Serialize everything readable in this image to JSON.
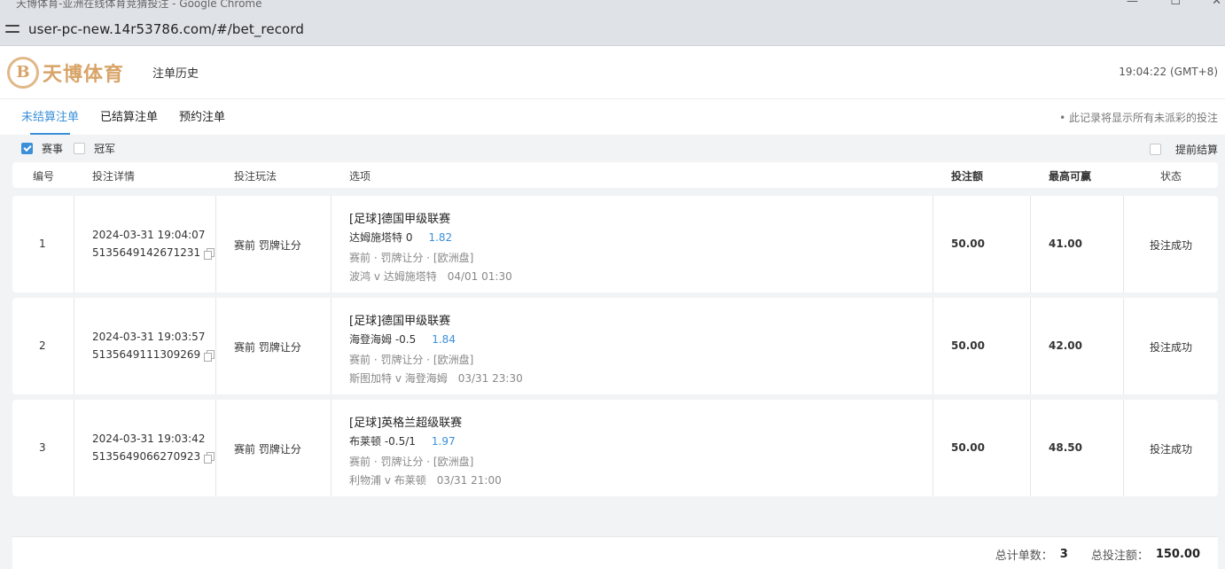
{
  "browser": {
    "window_title": "天博体育-亚洲在线体育竞猜投注 - Google Chrome",
    "url": "user-pc-new.14r53786.com/#/bet_record",
    "controls": {
      "minimize": "—",
      "maximize": "☐",
      "close": "✕"
    }
  },
  "header": {
    "logo_mark": "B",
    "logo_text": "天博体育",
    "nav_history": "注单历史",
    "clock": "19:04:22 (GMT+8)"
  },
  "tabs": [
    {
      "label": "未结算注单",
      "active": true
    },
    {
      "label": "已结算注单",
      "active": false
    },
    {
      "label": "预约注单",
      "active": false
    }
  ],
  "tabs_note": "• 此记录将显示所有未派彩的投注",
  "filters": {
    "event_label": "赛事",
    "event_checked": true,
    "champion_label": "冠军",
    "champion_checked": false,
    "early_settle_label": "提前结算",
    "early_settle_checked": false
  },
  "columns": {
    "no": "编号",
    "detail": "投注详情",
    "play": "投注玩法",
    "option": "选项",
    "stake": "投注额",
    "max_win": "最高可赢",
    "status": "状态"
  },
  "rows": [
    {
      "no": "1",
      "time": "2024-03-31 19:04:07",
      "order_id": "5135649142671231",
      "play": "赛前 罚牌让分",
      "league": "[足球]德国甲级联赛",
      "pick": "达姆施塔特 0",
      "odds": "1.82",
      "meta": "赛前 · 罚牌让分 · [欧洲盘]",
      "match": "波鸿 v 达姆施塔特",
      "match_time": "04/01 01:30",
      "stake": "50.00",
      "max_win": "41.00",
      "status": "投注成功"
    },
    {
      "no": "2",
      "time": "2024-03-31 19:03:57",
      "order_id": "5135649111309269",
      "play": "赛前 罚牌让分",
      "league": "[足球]德国甲级联赛",
      "pick": "海登海姆 -0.5",
      "odds": "1.84",
      "meta": "赛前 · 罚牌让分 · [欧洲盘]",
      "match": "斯图加特 v 海登海姆",
      "match_time": "03/31 23:30",
      "stake": "50.00",
      "max_win": "42.00",
      "status": "投注成功"
    },
    {
      "no": "3",
      "time": "2024-03-31 19:03:42",
      "order_id": "5135649066270923",
      "play": "赛前 罚牌让分",
      "league": "[足球]英格兰超级联赛",
      "pick": "布莱顿 -0.5/1",
      "odds": "1.97",
      "meta": "赛前 · 罚牌让分 · [欧洲盘]",
      "match": "利物浦 v 布莱顿",
      "match_time": "03/31 21:00",
      "stake": "50.00",
      "max_win": "48.50",
      "status": "投注成功"
    }
  ],
  "footer": {
    "count_label": "总计单数：",
    "count": "3",
    "total_label": "总投注额：",
    "total": "150.00"
  },
  "colors": {
    "accent": "#3b8fd9",
    "brand": "#d8a468"
  }
}
